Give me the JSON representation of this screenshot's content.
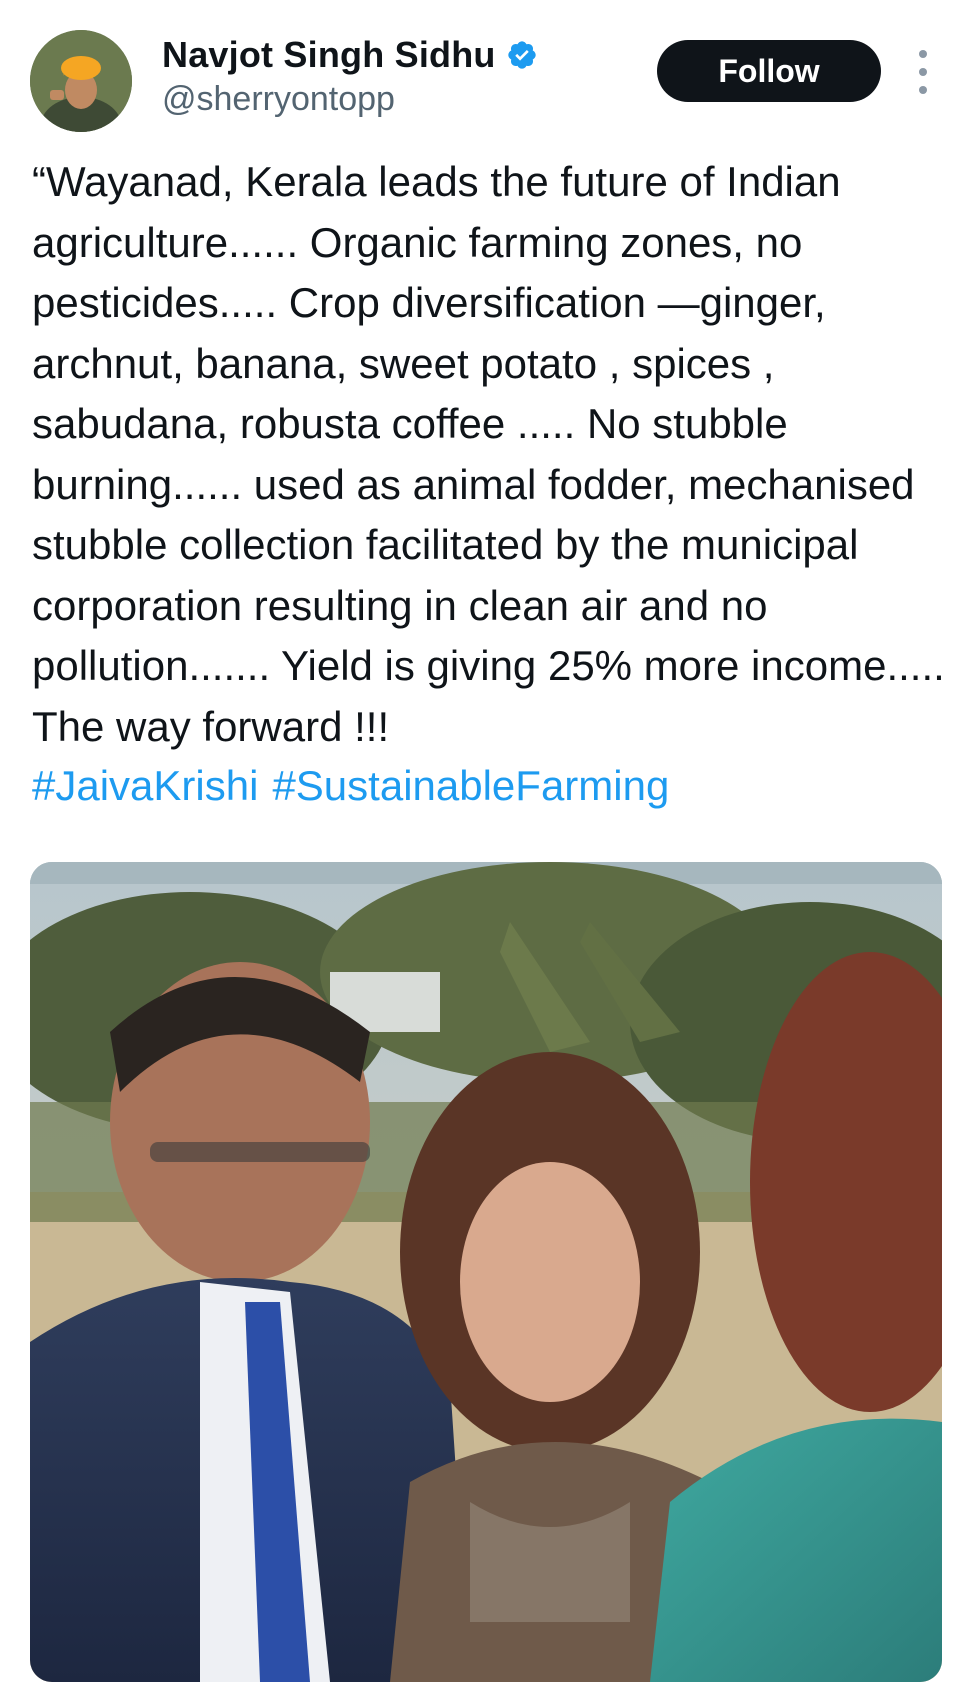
{
  "tweet": {
    "author": {
      "display_name": "Navjot Singh Sidhu",
      "handle": "@sherryontopp",
      "verified_icon": "verified-badge-icon",
      "avatar_icon": "avatar-photo"
    },
    "follow_label": "Follow",
    "more_icon": "more-options-icon",
    "text": "“Wayanad, Kerala leads the future of Indian agriculture...... Organic farming zones, no pesticides..... Crop diversification —ginger, archnut, banana, sweet potato , spices , sabudana, robusta coffee ..... No stubble burning...... used as animal fodder, mechanised stubble collection facilitated by the municipal corporation resulting in clean air and no pollution....... Yield is giving 25% more income..... The way forward !!!",
    "hashtags": [
      "#JaivaKrishi",
      "#SustainableFarming"
    ],
    "media_icon": "attached-photo"
  },
  "colors": {
    "text": "#0f1419",
    "secondary": "#536471",
    "link": "#1d9bf0",
    "follow_bg": "#0f1419",
    "verified": "#1d9bf0"
  }
}
